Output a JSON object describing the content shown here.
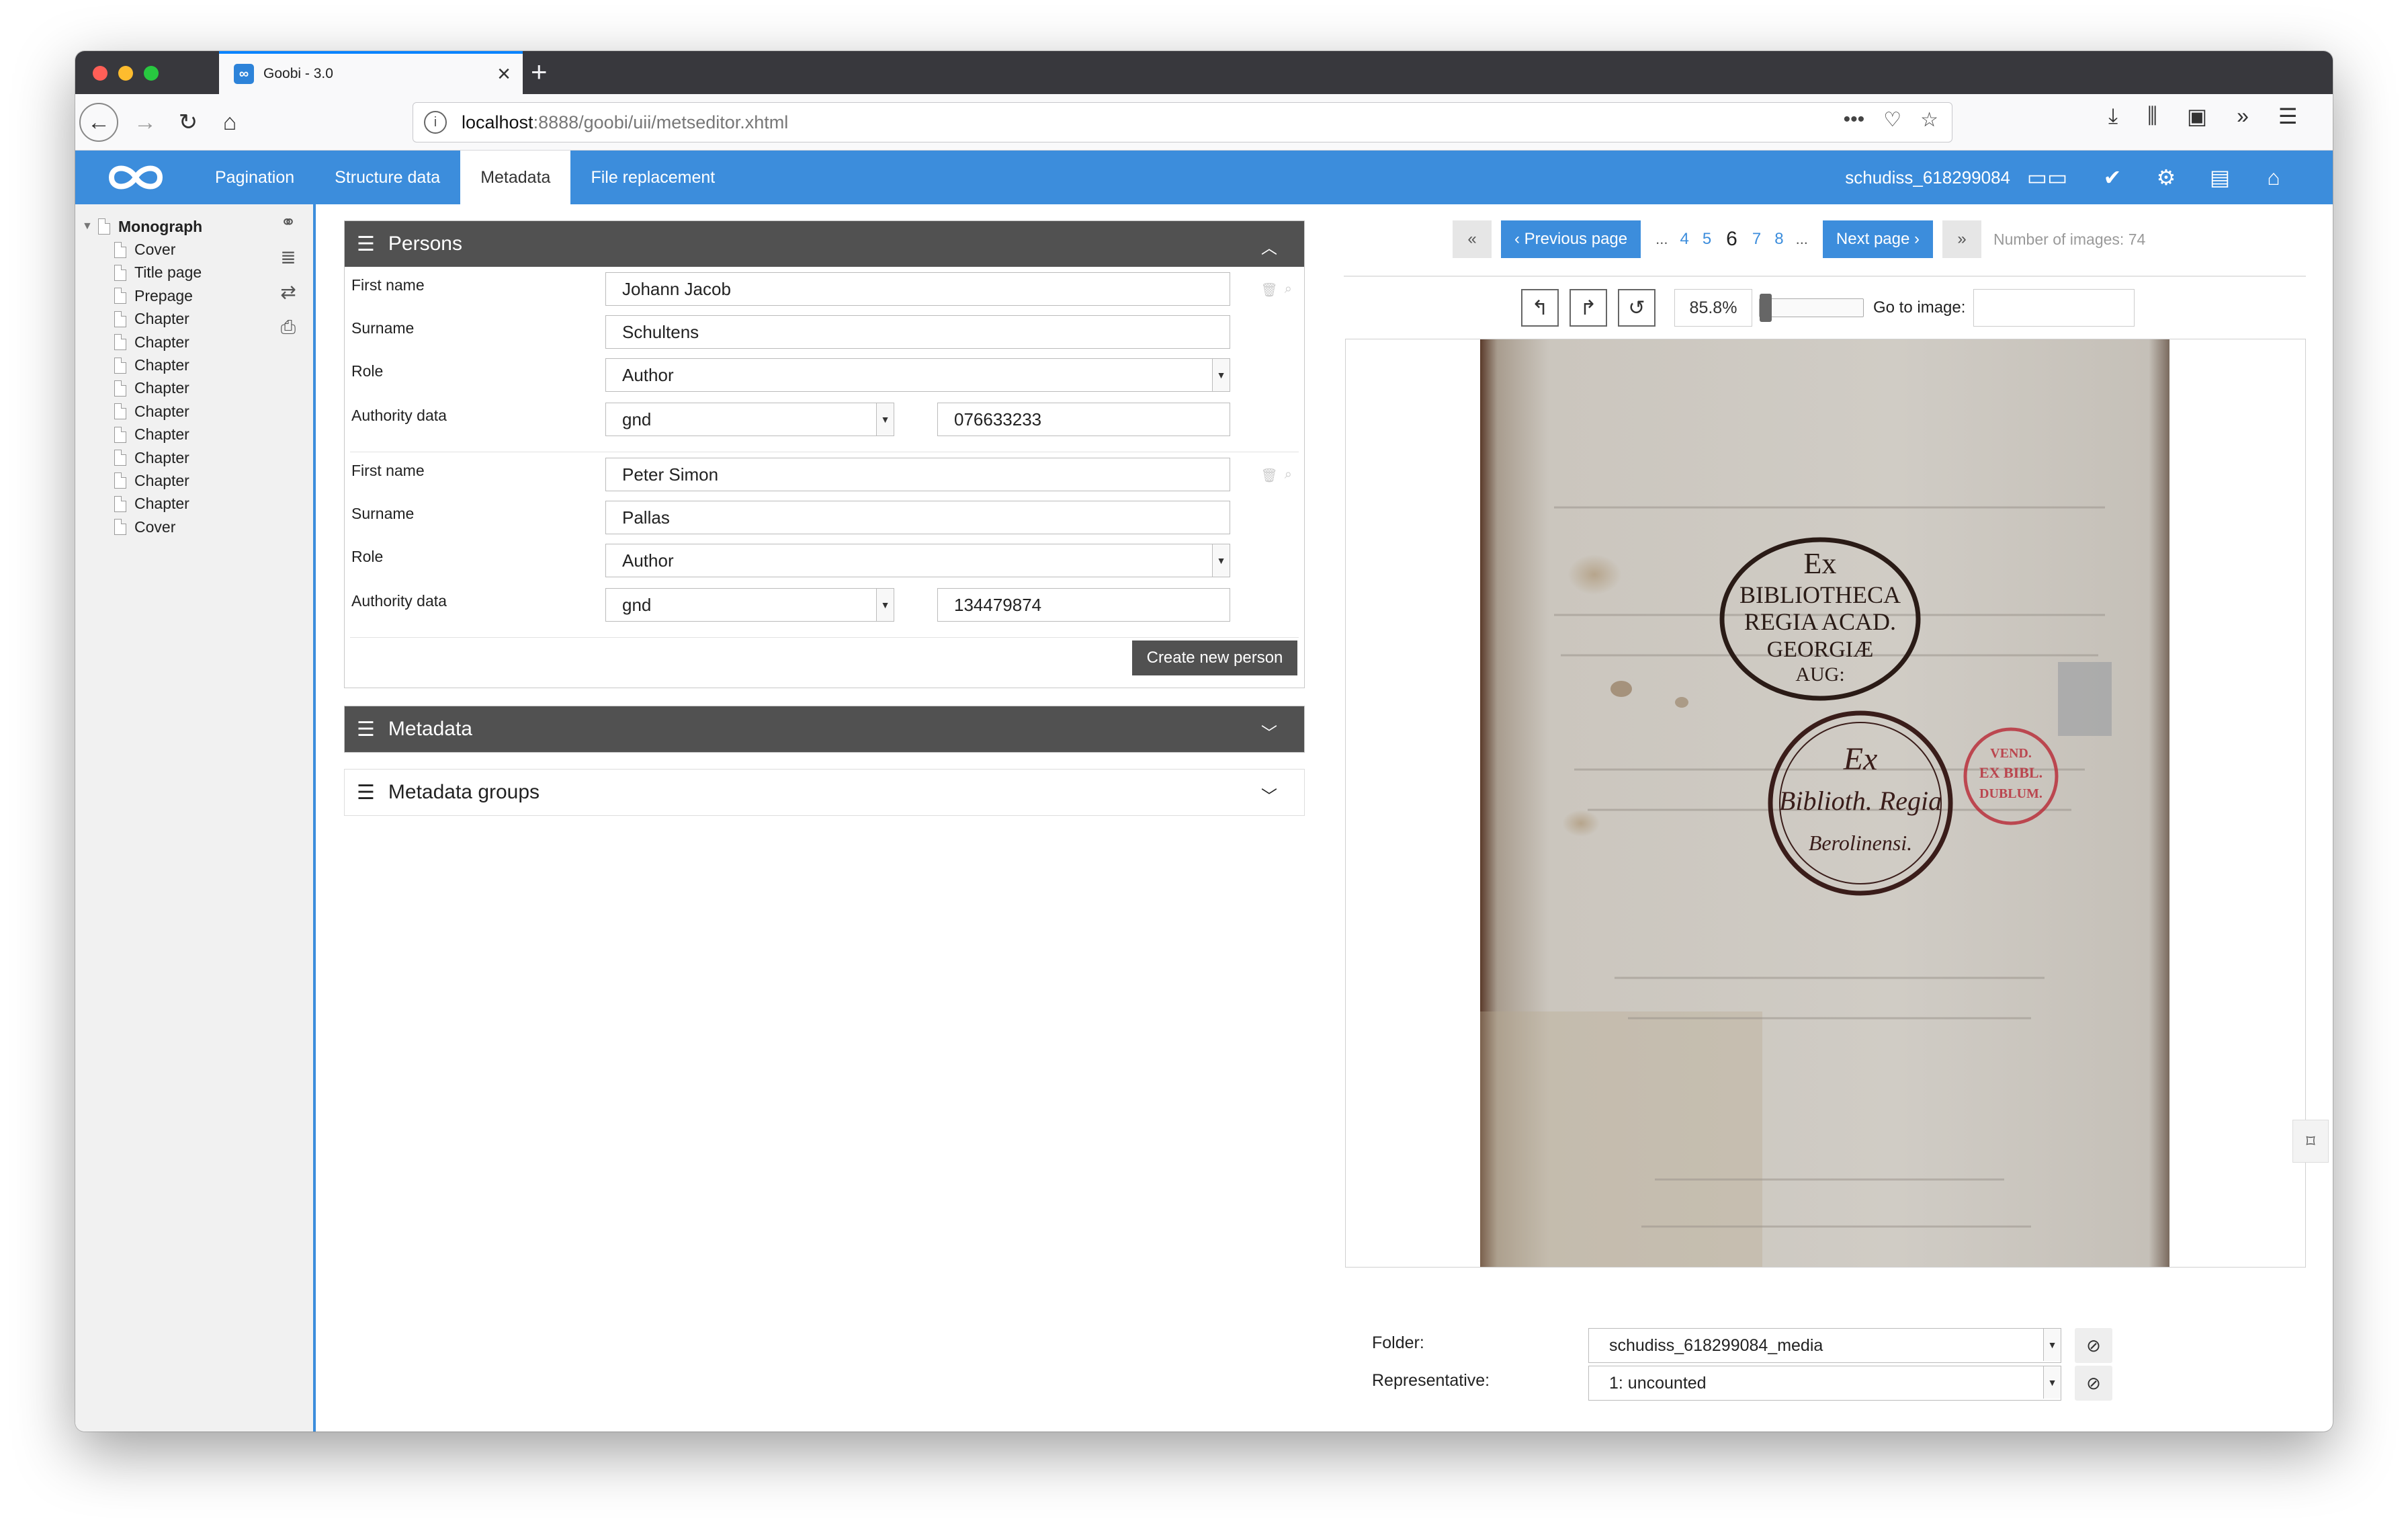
{
  "browser": {
    "tab_title": "Goobi - 3.0",
    "tab_favicon": "∞",
    "url_host": "localhost",
    "url_rest": ":8888/goobi/uii/metseditor.xhtml"
  },
  "app": {
    "nav": [
      "Pagination",
      "Structure data",
      "Metadata",
      "File replacement"
    ],
    "active_nav": "Metadata",
    "record_id": "schudiss_618299084"
  },
  "tree": {
    "root": "Monograph",
    "children": [
      "Cover",
      "Title page",
      "Prepage",
      "Chapter",
      "Chapter",
      "Chapter",
      "Chapter",
      "Chapter",
      "Chapter",
      "Chapter",
      "Chapter",
      "Chapter",
      "Cover"
    ]
  },
  "persons": {
    "title": "Persons",
    "labels": {
      "first_name": "First name",
      "surname": "Surname",
      "role": "Role",
      "authority": "Authority data"
    },
    "entries": [
      {
        "first_name": "Johann Jacob",
        "surname": "Schultens",
        "role": "Author",
        "authority_source": "gnd",
        "authority_id": "076633233"
      },
      {
        "first_name": "Peter Simon",
        "surname": "Pallas",
        "role": "Author",
        "authority_source": "gnd",
        "authority_id": "134479874"
      }
    ],
    "create_button": "Create new person"
  },
  "sections": {
    "metadata": "Metadata",
    "metadata_groups": "Metadata groups"
  },
  "viewer": {
    "prev": "Previous page",
    "next": "Next page",
    "pages_before": [
      "4",
      "5"
    ],
    "current_page": "6",
    "pages_after": [
      "7",
      "8"
    ],
    "ellipsis": "...",
    "image_count": "Number of images: 74",
    "zoom": "85.8%",
    "zoom_slider_fraction": 0.0,
    "goto_label": "Go to image:",
    "goto_value": ""
  },
  "image_text": {
    "stamp1": [
      "Ex",
      "BIBLIOTHECA",
      "REGIA ACAD.",
      "GEORGIÆ",
      "AUG:"
    ],
    "stamp2": [
      "Ex",
      "Biblioth. Regia",
      "Berolinensi."
    ],
    "stamp3": [
      "VEND.",
      "EX BIBL.",
      "DUBLUM."
    ]
  },
  "bottom": {
    "folder_label": "Folder:",
    "folder_value": "schudiss_618299084_media",
    "representative_label": "Representative:",
    "representative_value": "1: uncounted"
  },
  "colors": {
    "accent": "#3c8ddc",
    "panel_dark": "#515151"
  }
}
